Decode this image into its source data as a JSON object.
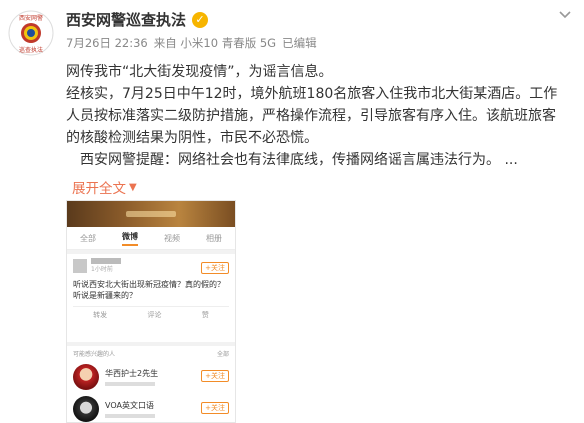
{
  "author": {
    "name": "西安网警巡查执法",
    "avatar_icon": "police-badge-icon",
    "verified_icon": "verified-icon",
    "avatar_text_top": "西安网警",
    "avatar_text_bottom": "巡查执法"
  },
  "meta": {
    "time": "7月26日 22:36",
    "source": "来自 小米10 青春版 5G",
    "edited": "已编辑"
  },
  "post": {
    "line1": "网传我市“北大街发现疫情”，为谣言信息。",
    "line2": "经核实，7月25日中午12时，境外航班180名旅客入住我市北大街某酒店。工作人员按标准落实二级防护措施，严格操作流程，引导旅客有序入住。该航班旅客的核酸检测结果为阴性，市民不必恐慌。",
    "line3": "西安网警提醒：网络社会也有法律底线，传播网络谣言属违法行为。 ..."
  },
  "expand": {
    "label": "展开全文",
    "icon": "chevron-down-icon"
  },
  "colors": {
    "accent": "#eb7350",
    "verified": "#f7b500"
  },
  "embedded": {
    "tabs": [
      "全部",
      "微博",
      "视频",
      "相册"
    ],
    "active_tab": "微博",
    "time": "1小时前",
    "follow": "+关注",
    "text": "听说西安北大街出现新冠疫情？真的假的？听说是新疆来的？",
    "actions": [
      "转发",
      "评论",
      "赞"
    ],
    "rec_title": "可能感兴趣的人",
    "rec_more": "全部",
    "rec_users": [
      "华西护士2先生",
      "VOA英文口语"
    ]
  }
}
